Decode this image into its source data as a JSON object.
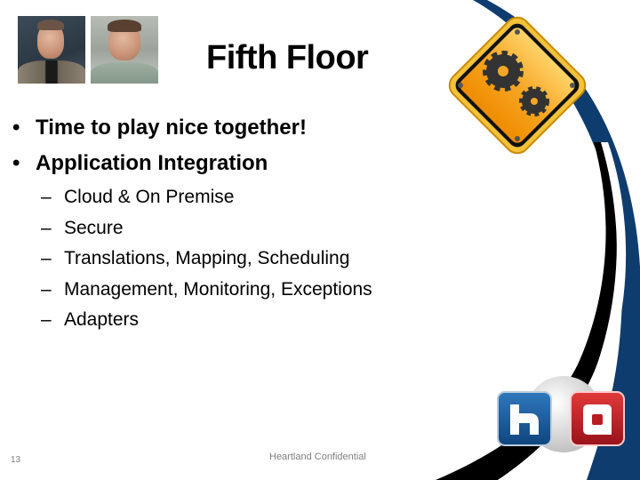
{
  "slide": {
    "title": "Fifth Floor",
    "photos": [
      {
        "name": "presenter-photo-1"
      },
      {
        "name": "presenter-photo-2"
      }
    ],
    "bullets": [
      {
        "marker": "•",
        "text": "Time to play nice together!"
      },
      {
        "marker": "•",
        "text": "Application Integration"
      }
    ],
    "sub_bullets": [
      {
        "marker": "–",
        "text": "Cloud & On Premise"
      },
      {
        "marker": "–",
        "text": "Secure"
      },
      {
        "marker": "–",
        "text": "Translations, Mapping, Scheduling"
      },
      {
        "marker": "–",
        "text": "Management, Monitoring, Exceptions"
      },
      {
        "marker": "–",
        "text": "Adapters"
      }
    ],
    "page_number": "13",
    "footer": "Heartland Confidential",
    "icons": {
      "sign": "gears-warning-sign-icon",
      "logo_h": "h",
      "logo_a": "a"
    },
    "colors": {
      "navy": "#0f3c6e",
      "black": "#000000",
      "sign_orange": "#f6a623",
      "logo_blue": "#1d5d9b",
      "logo_red": "#c1272d"
    }
  }
}
